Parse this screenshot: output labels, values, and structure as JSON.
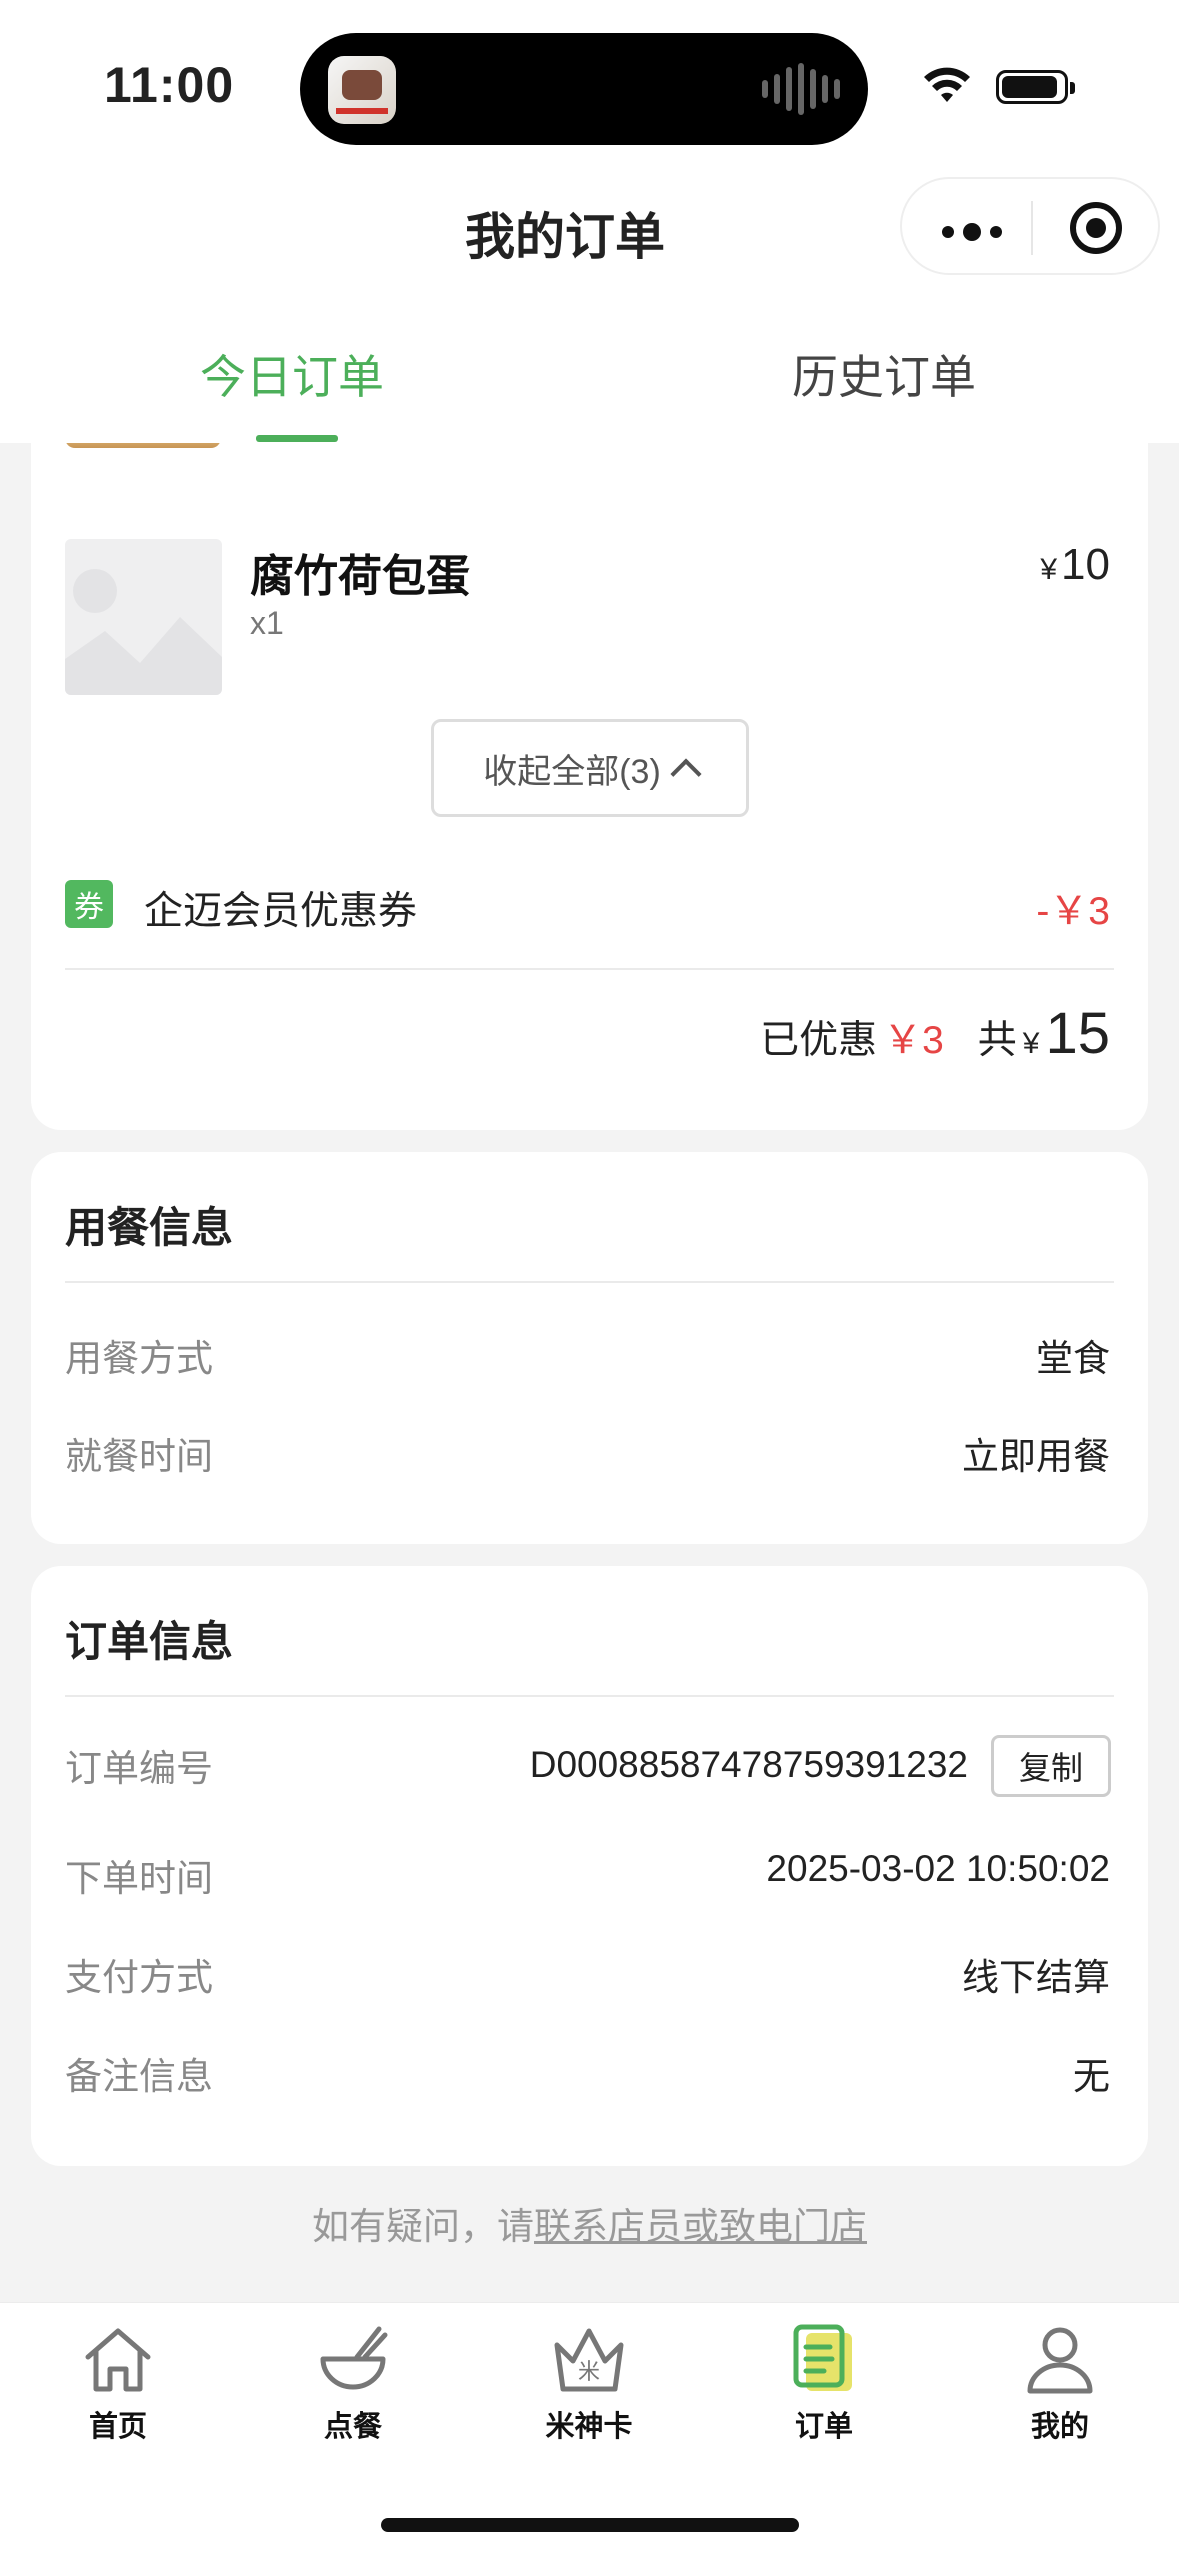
{
  "status_bar": {
    "time": "11:00"
  },
  "nav": {
    "title": "我的订单"
  },
  "tabs": [
    {
      "label": "今日订单",
      "active": true
    },
    {
      "label": "历史订单",
      "active": false
    }
  ],
  "order": {
    "item": {
      "name": "腐竹荷包蛋",
      "qty": "x1",
      "currency": "¥",
      "price": "10"
    },
    "collapse_label": "收起全部(3)",
    "coupon": {
      "badge": "券",
      "label": "企迈会员优惠券",
      "amount": "-￥3"
    },
    "summary": {
      "discount_label": "已优惠",
      "discount_value": "￥3",
      "total_label": "共",
      "currency": "¥",
      "total": "15"
    }
  },
  "dine_info": {
    "title": "用餐信息",
    "rows": [
      {
        "label": "用餐方式",
        "value": "堂食"
      },
      {
        "label": "就餐时间",
        "value": "立即用餐"
      }
    ]
  },
  "order_info": {
    "title": "订单信息",
    "order_no_label": "订单编号",
    "order_no": "D000885874787593912​32",
    "copy_label": "复制",
    "rows": [
      {
        "label": "下单时间",
        "value": "2025-03-02 10:50:02"
      },
      {
        "label": "支付方式",
        "value": "线下结算"
      },
      {
        "label": "备注信息",
        "value": "无"
      }
    ]
  },
  "help": {
    "prefix": "如有疑问，请",
    "link": "联系店员或致电门店"
  },
  "tabbar": [
    {
      "label": "首页",
      "icon": "home-icon"
    },
    {
      "label": "点餐",
      "icon": "bowl-icon"
    },
    {
      "label": "米神卡",
      "icon": "crown-card-icon"
    },
    {
      "label": "订单",
      "icon": "order-list-icon",
      "active": true
    },
    {
      "label": "我的",
      "icon": "user-icon"
    }
  ],
  "colors": {
    "accent": "#4caf5a",
    "discount": "#e64545"
  }
}
